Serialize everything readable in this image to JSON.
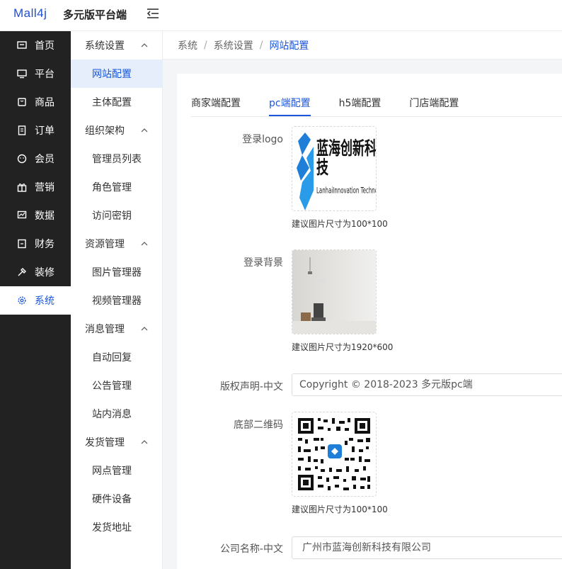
{
  "header": {
    "logo_text": "Mall4j",
    "title": "多元版平台端"
  },
  "nav": [
    {
      "label": "首页",
      "icon": "home-icon"
    },
    {
      "label": "平台",
      "icon": "monitor-icon"
    },
    {
      "label": "商品",
      "icon": "goods-icon"
    },
    {
      "label": "订单",
      "icon": "order-icon"
    },
    {
      "label": "会员",
      "icon": "member-icon"
    },
    {
      "label": "营销",
      "icon": "gift-icon"
    },
    {
      "label": "数据",
      "icon": "chart-icon"
    },
    {
      "label": "财务",
      "icon": "finance-icon"
    },
    {
      "label": "装修",
      "icon": "decorate-icon"
    },
    {
      "label": "系统",
      "icon": "gear-icon"
    }
  ],
  "submenu": {
    "groups": [
      {
        "label": "系统设置",
        "items": [
          "网站配置",
          "主体配置"
        ]
      },
      {
        "label": "组织架构",
        "items": [
          "管理员列表",
          "角色管理",
          "访问密钥"
        ]
      },
      {
        "label": "资源管理",
        "items": [
          "图片管理器",
          "视频管理器"
        ]
      },
      {
        "label": "消息管理",
        "items": [
          "自动回复",
          "公告管理",
          "站内消息"
        ]
      },
      {
        "label": "发货管理",
        "items": [
          "网点管理",
          "硬件设备",
          "发货地址"
        ]
      }
    ]
  },
  "breadcrumb": {
    "items": [
      "系统",
      "系统设置"
    ],
    "current": "网站配置",
    "separator": "/"
  },
  "tabs": [
    "商家端配置",
    "pc端配置",
    "h5端配置",
    "门店端配置"
  ],
  "form": {
    "login_logo_label": "登录logo",
    "login_logo_hint": "建议图片尺寸为100*100",
    "logo_image_text": "蓝海创新科技",
    "logo_image_subtext": "LanhaiInnovation Technology",
    "login_bg_label": "登录背景",
    "login_bg_hint": "建议图片尺寸为1920*600",
    "copyright_label": "版权声明-中文",
    "copyright_value": "Copyright © 2018-2023 多元版pc端",
    "qrcode_label": "底部二维码",
    "qrcode_hint": "建议图片尺寸为100*100",
    "company_label": "公司名称-中文",
    "company_value": "广州市蓝海创新科技有限公司"
  },
  "colors": {
    "accent": "#1a56db",
    "nav_bg": "#222222",
    "active_sub_bg": "#e6eefc"
  }
}
